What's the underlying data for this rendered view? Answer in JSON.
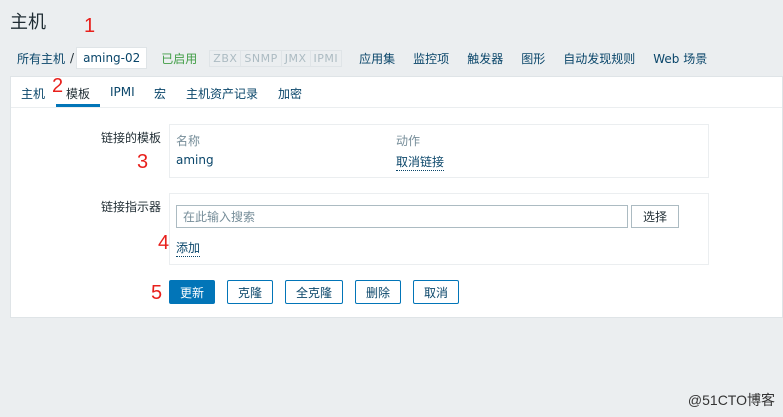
{
  "header": {
    "title": "主机"
  },
  "breadcrumb": {
    "all_hosts": "所有主机",
    "separator": "/",
    "current_host": "aming-02",
    "status": "已启用",
    "availability": [
      "ZBX",
      "SNMP",
      "JMX",
      "IPMI"
    ],
    "nav": [
      "应用集",
      "监控项",
      "触发器",
      "图形",
      "自动发现规则",
      "Web 场景"
    ]
  },
  "tabs": [
    {
      "label": "主机"
    },
    {
      "label": "模板"
    },
    {
      "label": "IPMI"
    },
    {
      "label": "宏"
    },
    {
      "label": "主机资产记录"
    },
    {
      "label": "加密"
    }
  ],
  "linked_templates": {
    "label": "链接的模板",
    "col_name": "名称",
    "col_action": "动作",
    "rows": [
      {
        "name": "aming",
        "action": "取消链接"
      }
    ]
  },
  "link_indicators": {
    "label": "链接指示器",
    "search_placeholder": "在此输入搜索",
    "select_label": "选择",
    "add_label": "添加"
  },
  "buttons": {
    "update": "更新",
    "clone": "克隆",
    "full_clone": "全克隆",
    "delete": "删除",
    "cancel": "取消"
  },
  "annotations": [
    "1",
    "2",
    "3",
    "4",
    "5"
  ],
  "watermark": "@51CTO博客",
  "colors": {
    "accent": "#0275b8",
    "link": "#0a466a",
    "enabled": "#429e47",
    "annotation": "#e8201c"
  }
}
